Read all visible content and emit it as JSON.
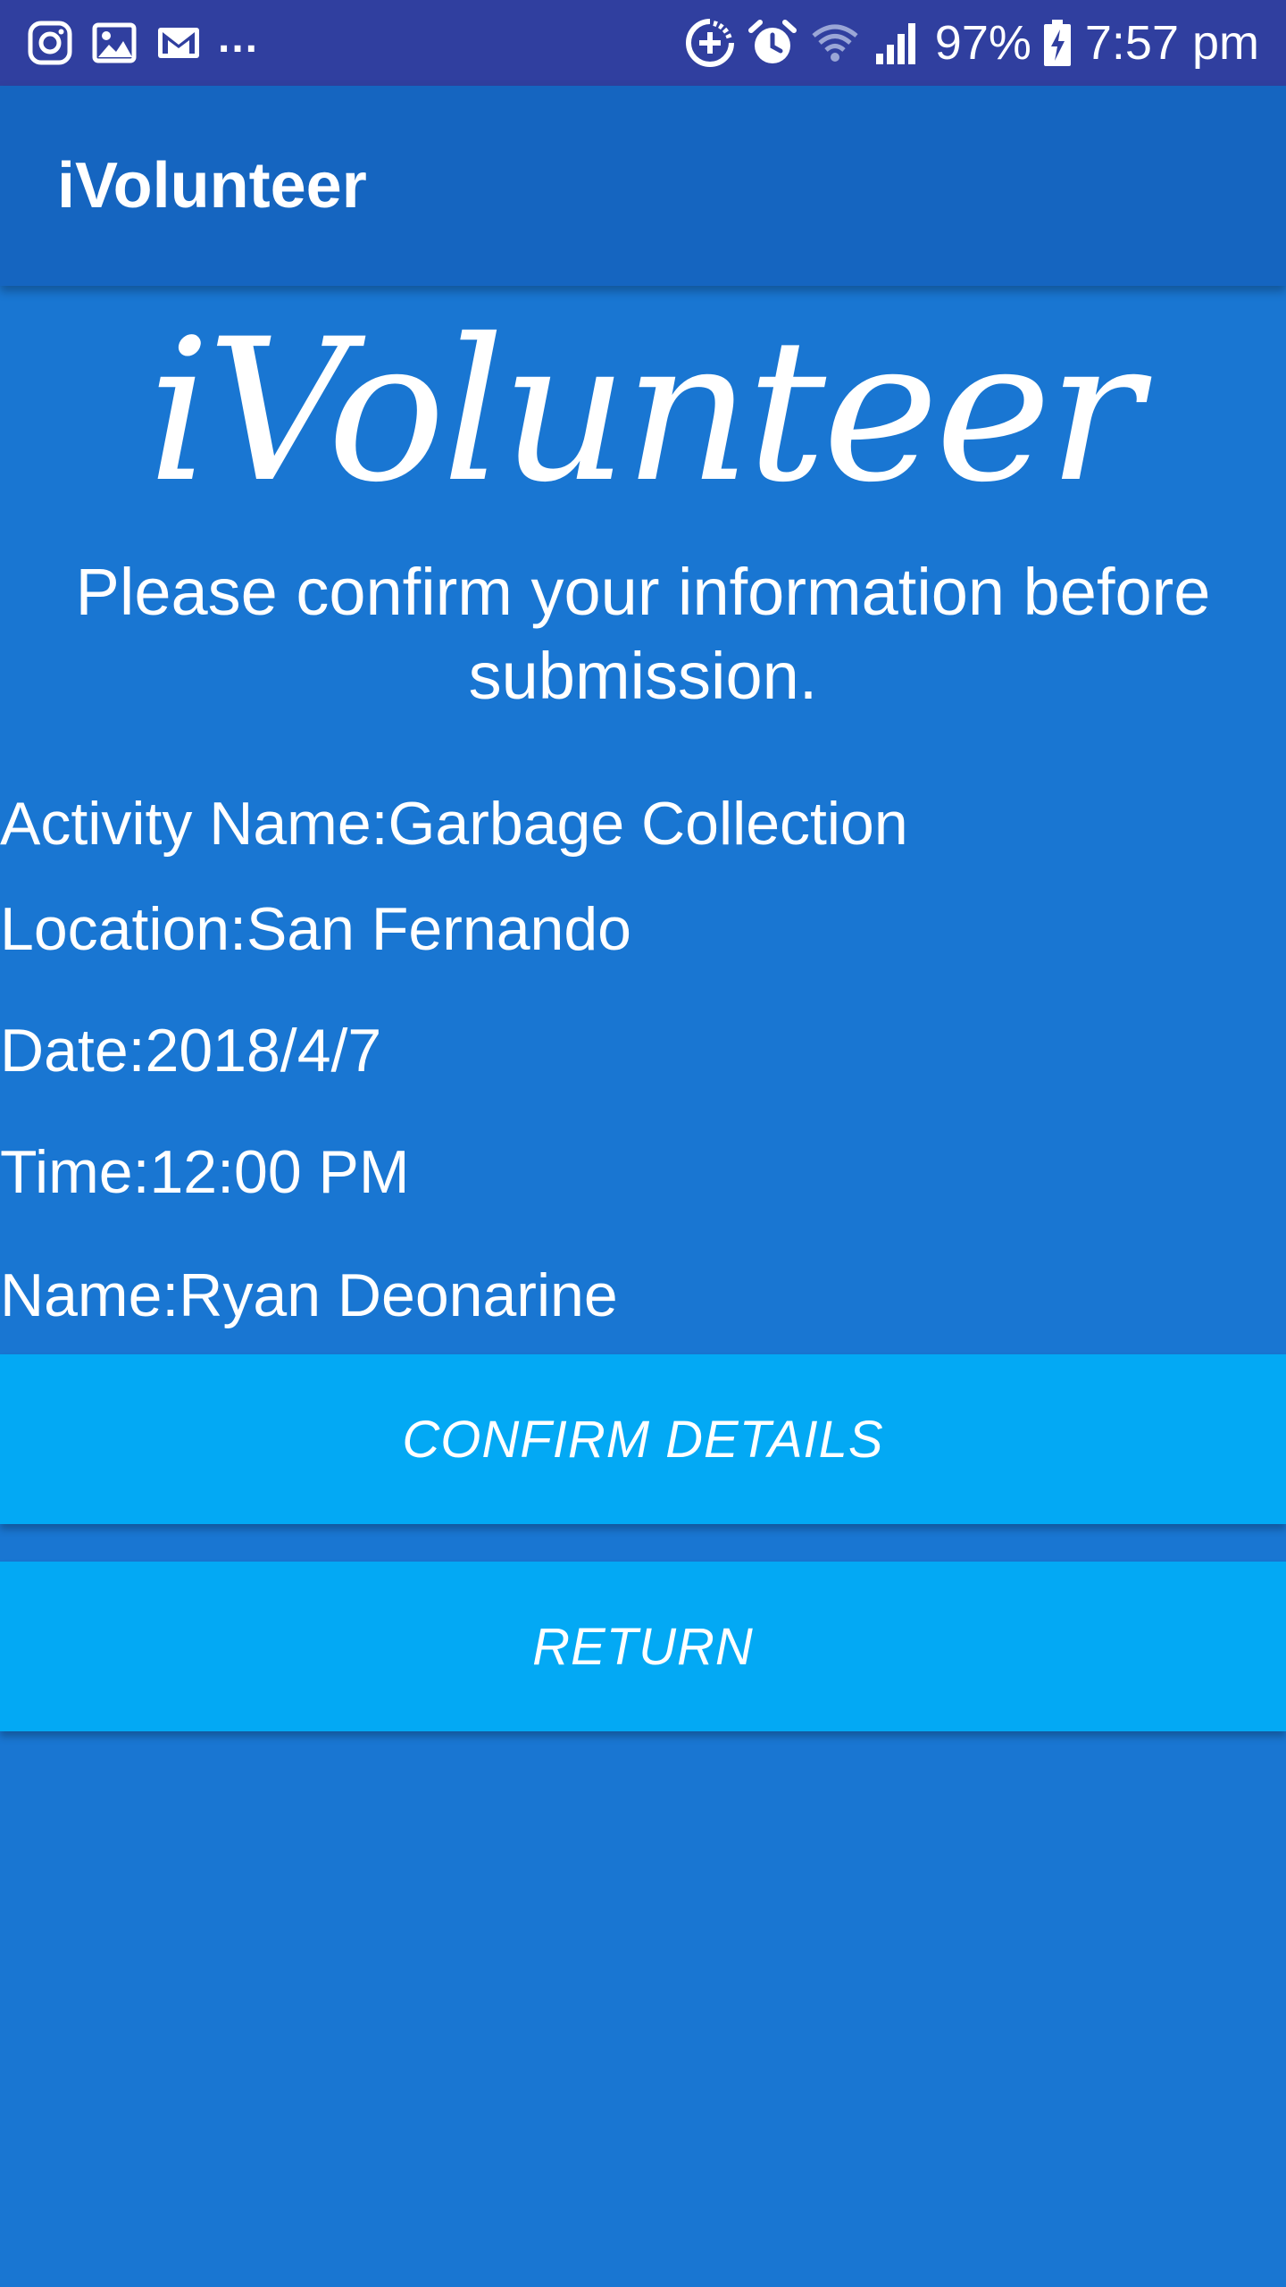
{
  "status_bar": {
    "left_icons": [
      "instagram-icon",
      "image-icon",
      "gmail-icon"
    ],
    "overflow": "...",
    "right_icons": [
      "data-saver-icon",
      "alarm-icon",
      "wifi-icon",
      "signal-icon"
    ],
    "battery_percent": "97%",
    "time": "7:57 pm",
    "colors": {
      "background": "#303f9f"
    }
  },
  "app_bar": {
    "title": "iVolunteer",
    "colors": {
      "background": "#1565c0"
    }
  },
  "logo": {
    "text": "iVolunteer"
  },
  "prompt": "Please confirm your information before submission.",
  "details": {
    "activity": "Activity Name:Garbage Collection",
    "location": "Location:San Fernando",
    "date": "Date:2018/4/7",
    "time": "Time:12:00 PM",
    "name": "Name:Ryan Deonarine"
  },
  "buttons": {
    "confirm_label": "CONFIRM DETAILS",
    "return_label": "RETURN",
    "color": "#03a9f4"
  },
  "colors": {
    "page_background": "#1976d2",
    "text": "#ffffff"
  }
}
